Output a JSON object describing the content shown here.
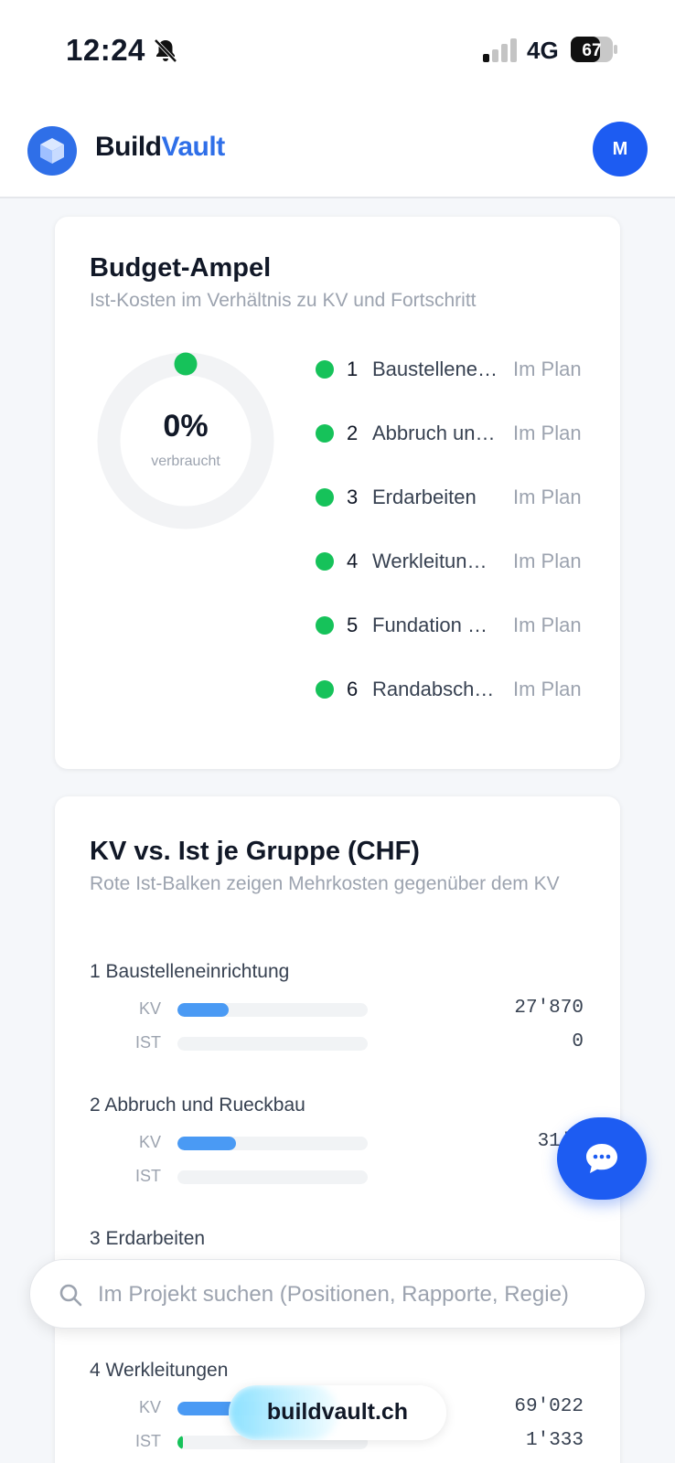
{
  "status_bar": {
    "time": "12:24",
    "network": "4G",
    "battery": "67"
  },
  "header": {
    "brand_part1": "Build",
    "brand_part2": "Vault",
    "avatar_initial": "M"
  },
  "colors": {
    "primary": "#1d5cf2",
    "brand_blue": "#2f6fe8",
    "ok_green": "#16c25a",
    "kv_bar": "#4a9af4",
    "ist_bar": "#16c25a"
  },
  "budget_card": {
    "title": "Budget-Ampel",
    "subtitle": "Ist-Kosten im Verhältnis zu KV und Fortschritt",
    "donut_value": "0%",
    "donut_label": "verbraucht",
    "consumed_fraction": 0,
    "items": [
      {
        "num": "1",
        "name": "Baustellene…",
        "status": "Im Plan"
      },
      {
        "num": "2",
        "name": "Abbruch un…",
        "status": "Im Plan"
      },
      {
        "num": "3",
        "name": "Erdarbeiten",
        "status": "Im Plan"
      },
      {
        "num": "4",
        "name": "Werkleitun…",
        "status": "Im Plan"
      },
      {
        "num": "5",
        "name": "Fundation …",
        "status": "Im Plan"
      },
      {
        "num": "6",
        "name": "Randabsch…",
        "status": "Im Plan"
      }
    ]
  },
  "kv_card": {
    "title": "KV vs. Ist je Gruppe (CHF)",
    "subtitle": "Rote Ist-Balken zeigen Mehrkosten gegenüber dem KV",
    "kv_label": "KV",
    "ist_label": "IST",
    "groups": [
      {
        "title": "1 Baustelleneinrichtung",
        "kv_value": "27'870",
        "ist_value": "0",
        "kv_fraction": 0.27,
        "ist_fraction": 0
      },
      {
        "title": "2 Abbruch und Rueckbau",
        "kv_value": "31'7",
        "ist_value": "",
        "kv_fraction": 0.31,
        "ist_fraction": 0
      },
      {
        "title": "3 Erdarbeiten",
        "kv_value": "",
        "ist_value": "",
        "kv_fraction": 0,
        "ist_fraction": 0
      },
      {
        "title": "4 Werkleitungen",
        "kv_value": "69'022",
        "ist_value": "1'333",
        "kv_fraction": 0.67,
        "ist_fraction": 0.013
      }
    ]
  },
  "search": {
    "placeholder": "Im Projekt suchen (Positionen, Rapporte, Regie)"
  },
  "url_bar": {
    "domain": "buildvault.ch"
  }
}
